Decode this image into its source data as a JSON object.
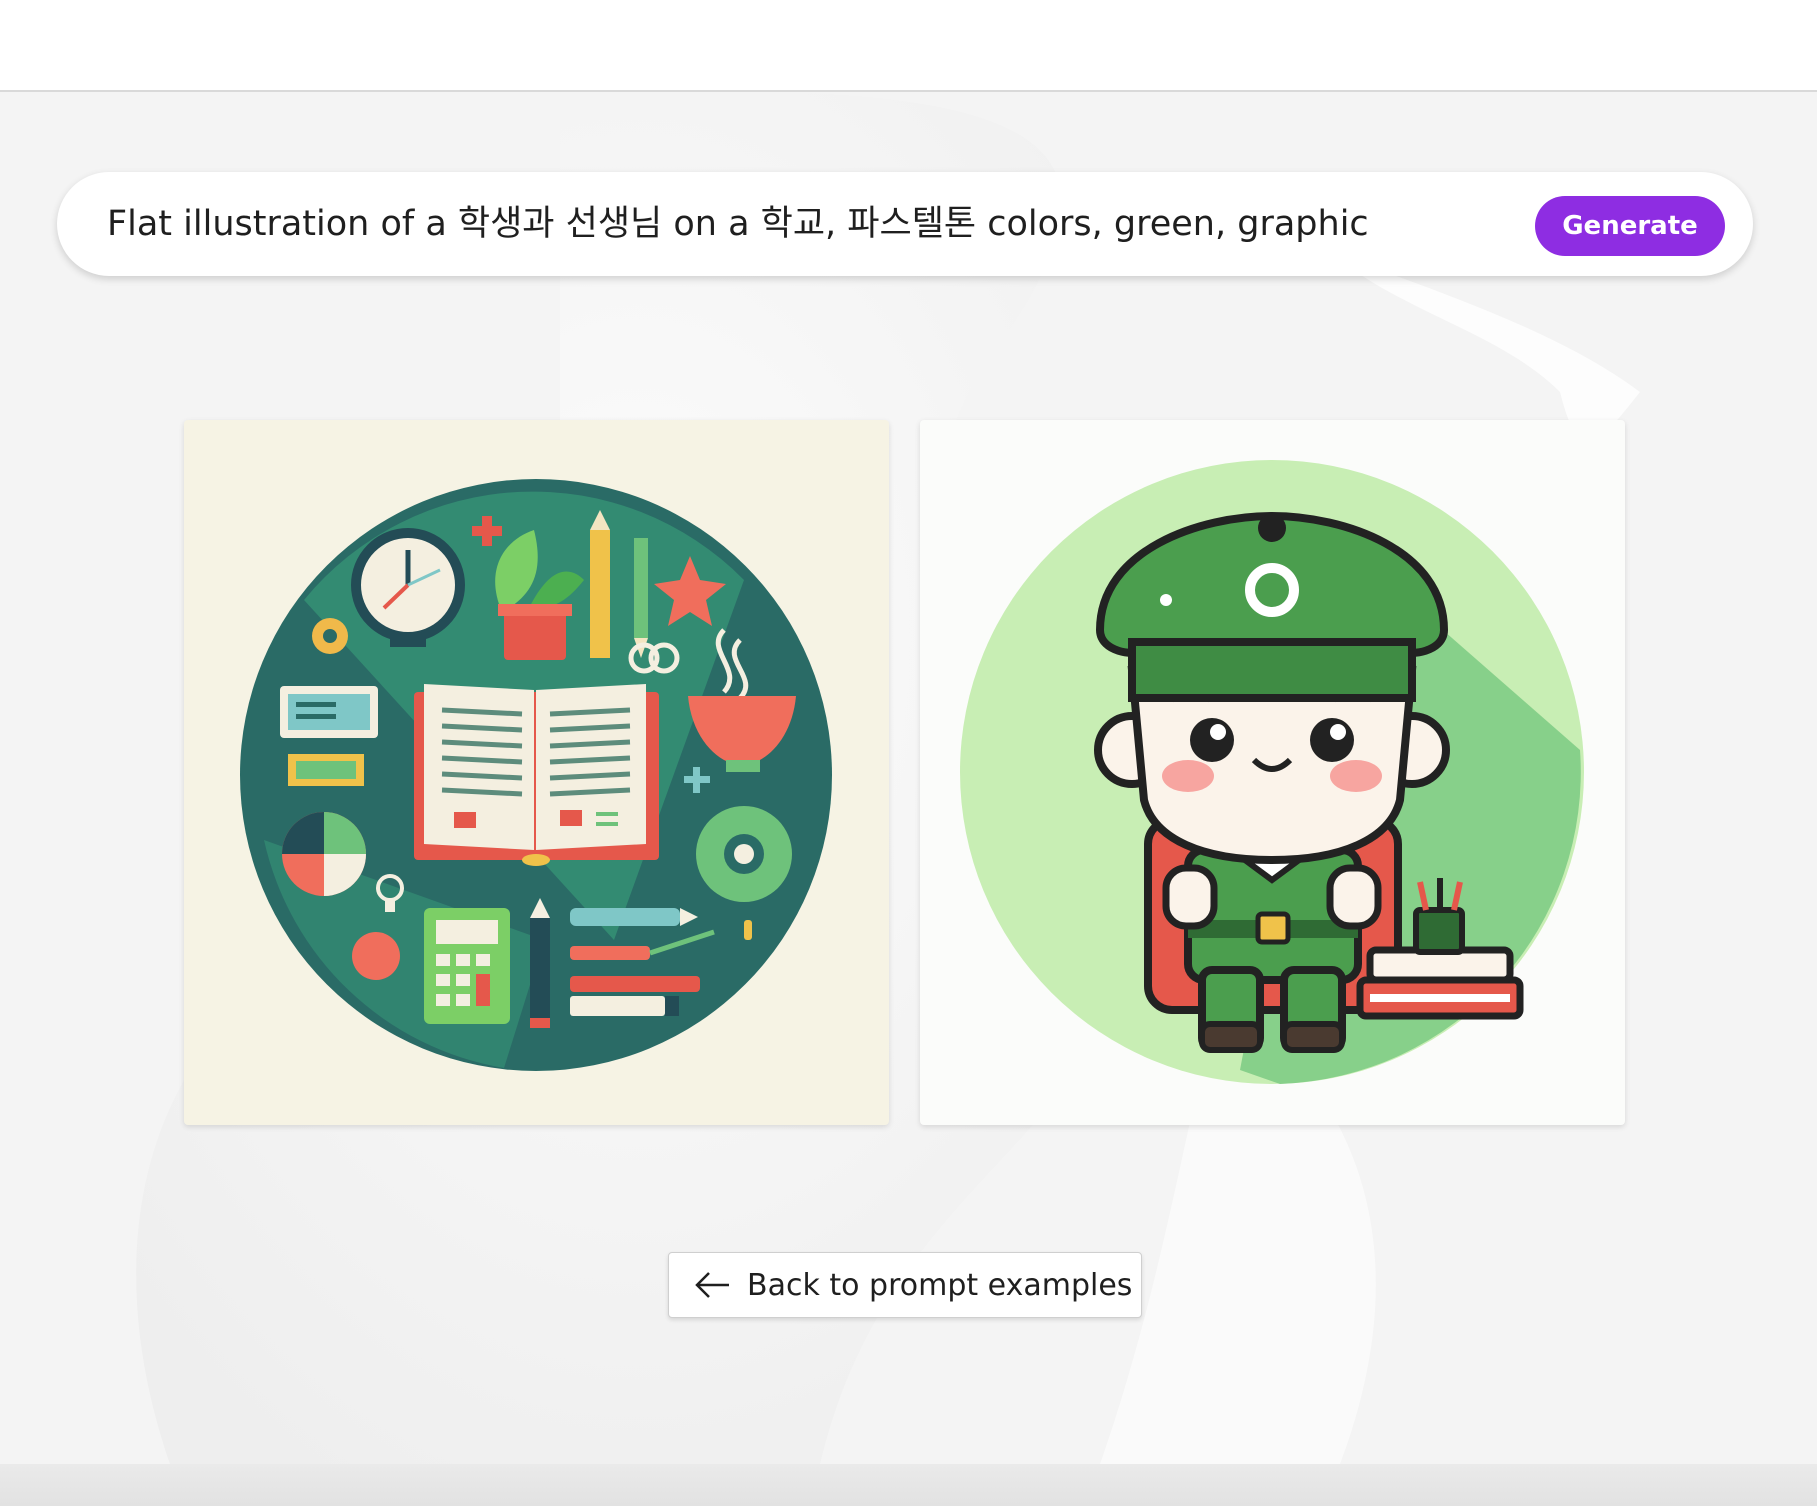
{
  "prompt": {
    "text": "Flat illustration of a 학생과 선생님 on a 학교, 파스텔톤 colors, green, graphic",
    "generate_label": "Generate"
  },
  "gallery": {
    "images": [
      {
        "icon": "school-supplies-illustration"
      },
      {
        "icon": "student-character-illustration"
      }
    ]
  },
  "back_button": {
    "label": "Back to prompt examples",
    "icon": "arrow-left-icon"
  },
  "colors": {
    "accent": "#8e2de2",
    "background": "#f4f4f4",
    "green_dark": "#2f8f6a",
    "green_light": "#c8eeb4"
  }
}
